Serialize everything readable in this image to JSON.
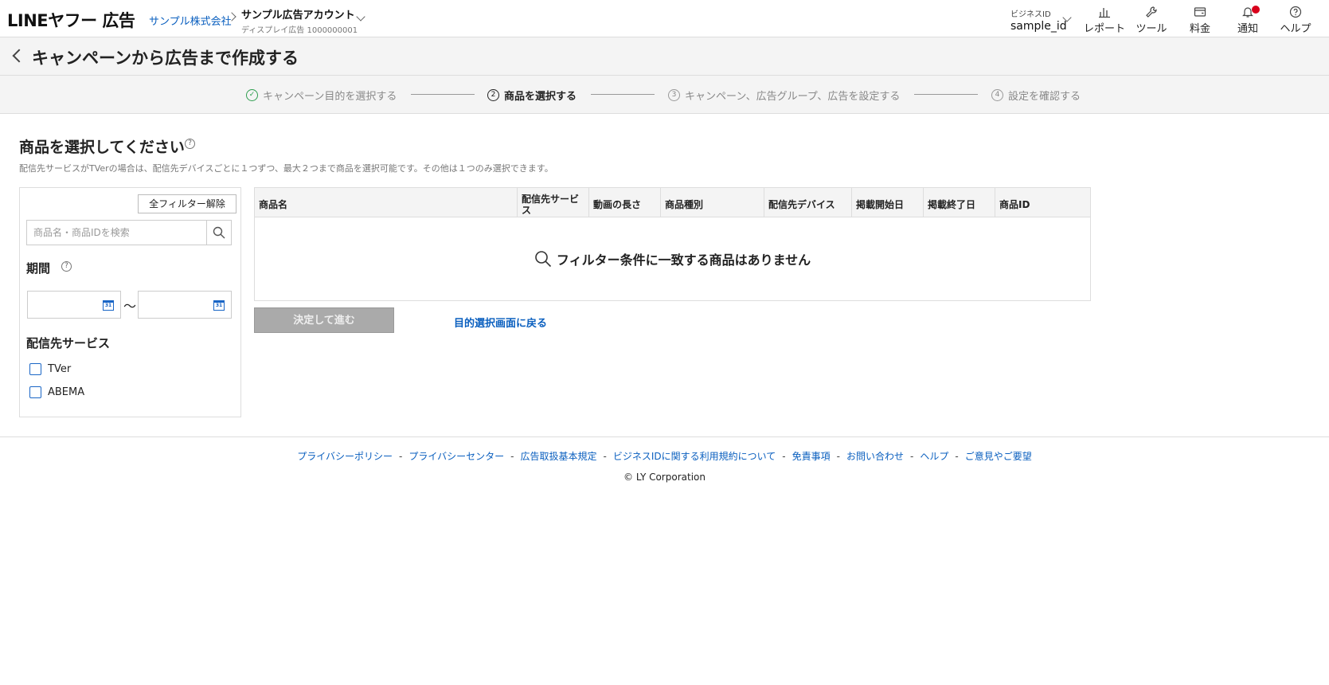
{
  "header": {
    "logo": "LINEヤフー 広告",
    "company": "サンプル株式会社",
    "account_name": "サンプル広告アカウント",
    "account_sub": "ディスプレイ広告 1000000001",
    "business_id_label": "ビジネスID",
    "business_id_value": "sample_id",
    "nav": {
      "report": "レポート",
      "tools": "ツール",
      "billing": "料金",
      "notifications": "通知",
      "help": "ヘルプ"
    }
  },
  "title_bar": {
    "title": "キャンペーンから広告まで作成する"
  },
  "stepper": {
    "steps": [
      {
        "label": "キャンペーン目的を選択する",
        "marker": "✓",
        "state": "done"
      },
      {
        "label": "商品を選択する",
        "marker": "2",
        "state": "active"
      },
      {
        "label": "キャンペーン、広告グループ、広告を設定する",
        "marker": "3",
        "state": "pending"
      },
      {
        "label": "設定を確認する",
        "marker": "4",
        "state": "pending"
      }
    ]
  },
  "section": {
    "title": "商品を選択してください",
    "help_icon": "?",
    "description": "配信先サービスがTVerの場合は、配信先デバイスごとに１つずつ、最大２つまで商品を選択可能です。その他は１つのみ選択できます。"
  },
  "filters": {
    "clear_all": "全フィルター解除",
    "search_placeholder": "商品名・商品IDを検索",
    "period_label": "期間",
    "date_separator": "〜",
    "calendar_text": "31",
    "service_label": "配信先サービス",
    "services": [
      {
        "label": "TVer",
        "checked": false
      },
      {
        "label": "ABEMA",
        "checked": false
      }
    ]
  },
  "table": {
    "columns": [
      "商品名",
      "配信先サービス",
      "動画の長さ",
      "商品種別",
      "配信先デバイス",
      "掲載開始日",
      "掲載終了日",
      "商品ID"
    ],
    "empty_message": "フィルター条件に一致する商品はありません"
  },
  "actions": {
    "proceed": "決定して進む",
    "back": "目的選択画面に戻る"
  },
  "footer": {
    "links": [
      "プライバシーポリシー",
      "プライバシーセンター",
      "広告取扱基本規定",
      "ビジネスIDに関する利用規約について",
      "免責事項",
      "お問い合わせ",
      "ヘルプ",
      "ご意見やご要望"
    ],
    "separator": "-",
    "copyright": "© LY Corporation"
  },
  "colors": {
    "link": "#0a5fbf",
    "checkbox": "#1a66c6",
    "notification_dot": "#d8001b",
    "disabled_button": "#aaaaaa"
  }
}
